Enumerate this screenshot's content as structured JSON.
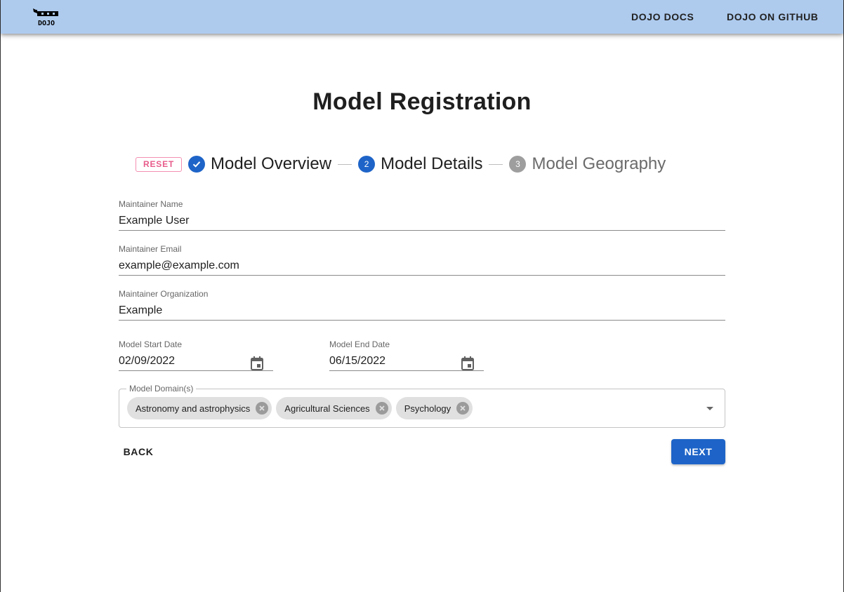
{
  "header": {
    "logo_text": "DOJO",
    "links": [
      {
        "label": "DOJO DOCS"
      },
      {
        "label": "DOJO ON GITHUB"
      }
    ],
    "background_color": "#aecbee"
  },
  "page": {
    "title": "Model Registration"
  },
  "stepper": {
    "reset_label": "RESET",
    "steps": [
      {
        "label": "Model Overview",
        "status": "completed",
        "icon": "check-icon"
      },
      {
        "label": "Model Details",
        "status": "active",
        "number": "2"
      },
      {
        "label": "Model Geography",
        "status": "pending",
        "number": "3"
      }
    ]
  },
  "form": {
    "maintainer_name": {
      "label": "Maintainer Name",
      "value": "Example User"
    },
    "maintainer_email": {
      "label": "Maintainer Email",
      "value": "example@example.com"
    },
    "maintainer_organization": {
      "label": "Maintainer Organization",
      "value": "Example"
    },
    "start_date": {
      "label": "Model Start Date",
      "value": "02/09/2022"
    },
    "end_date": {
      "label": "Model End Date",
      "value": "06/15/2022"
    },
    "domains": {
      "label": "Model Domain(s)",
      "selected": [
        "Astronomy and astrophysics",
        "Agricultural Sciences",
        "Psychology"
      ]
    }
  },
  "actions": {
    "back_label": "BACK",
    "next_label": "NEXT",
    "accent_color": "#1e64c8"
  }
}
